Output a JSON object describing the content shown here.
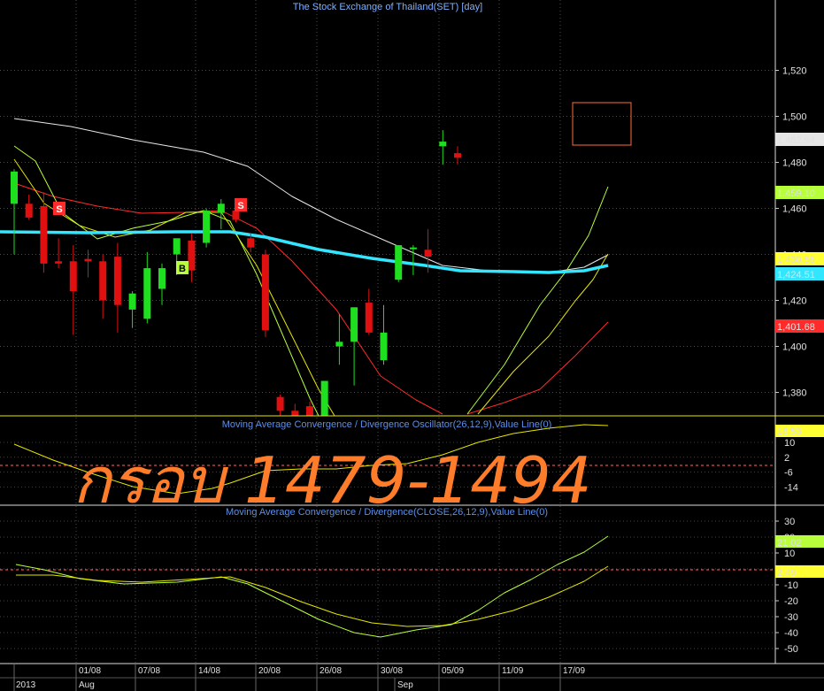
{
  "title": "The Stock Exchange of Thailand(SET) [day]",
  "overlay_text": "กรอบ 1479-1494",
  "x_axis": {
    "year_label": "2013",
    "month_labels": [
      "Aug",
      "Sep"
    ],
    "date_ticks": [
      "01/08",
      "07/08",
      "14/08",
      "20/08",
      "26/08",
      "30/08",
      "05/09",
      "11/09",
      "17/09"
    ]
  },
  "price_panel": {
    "y_ticks": [
      "1,520",
      "1,500",
      "1,480",
      "1,460",
      "1,440",
      "1,420",
      "1,400",
      "1,380"
    ],
    "value_badges": [
      {
        "text": "1,482.94",
        "bg": "#e6e6e6",
        "fg": "#000000"
      },
      {
        "text": "1,459.10",
        "bg": "#b6ff3a",
        "fg": "#000000"
      },
      {
        "text": "1,430.56",
        "bg": "#ffff33",
        "fg": "#000000"
      },
      {
        "text": "1,424.51",
        "bg": "#33e6ff",
        "fg": "#000000"
      },
      {
        "text": "1,401.68",
        "bg": "#ff2a2a",
        "fg": "#000000"
      }
    ],
    "signals": [
      {
        "text": "S",
        "kind": "sell"
      },
      {
        "text": "S",
        "kind": "sell"
      },
      {
        "text": "B",
        "kind": "buy"
      }
    ]
  },
  "osc_panel": {
    "title": "Moving Average Convergence / Divergence Oscillator(26,12,9),Value Line(0)",
    "y_ticks": [
      "10",
      "2",
      "-6",
      "-14"
    ],
    "value_badge": {
      "text": "18.53",
      "bg": "#ffff33",
      "fg": "#000000"
    }
  },
  "macd_panel": {
    "title": "Moving Average Convergence / Divergence(CLOSE,26,12,9),Value Line(0)",
    "y_ticks": [
      "30",
      "20",
      "10",
      "0",
      "-10",
      "-20",
      "-30",
      "-40",
      "-50"
    ],
    "value_badges": [
      {
        "text": "21.02",
        "bg": "#b6ff3a",
        "fg": "#000000"
      },
      {
        "text": "2.49",
        "bg": "#ffff33",
        "fg": "#000000"
      }
    ]
  },
  "colors": {
    "up": "#1fe01f",
    "down": "#e01010",
    "ma_white": "#e8e8e8",
    "ma_yellow": "#e6e600",
    "ma_green": "#b6ff3a",
    "ma_red": "#ff2a2a",
    "ma_cyan": "#33e6ff"
  },
  "chart_data": {
    "type": "candlestick",
    "title": "The Stock Exchange of Thailand(SET) [day]",
    "x_ticks": [
      "01/08",
      "07/08",
      "14/08",
      "20/08",
      "26/08",
      "30/08",
      "05/09",
      "11/09",
      "17/09"
    ],
    "ylim": [
      1370,
      1530
    ],
    "candles": [
      {
        "o": 1462,
        "h": 1477,
        "l": 1440,
        "c": 1476
      },
      {
        "o": 1462,
        "h": 1466,
        "l": 1455,
        "c": 1456
      },
      {
        "o": 1461,
        "h": 1467,
        "l": 1432,
        "c": 1436
      },
      {
        "o": 1437,
        "h": 1447,
        "l": 1434,
        "c": 1436
      },
      {
        "o": 1437,
        "h": 1444,
        "l": 1405,
        "c": 1424
      },
      {
        "o": 1438,
        "h": 1442,
        "l": 1430,
        "c": 1437
      },
      {
        "o": 1437,
        "h": 1440,
        "l": 1412,
        "c": 1420
      },
      {
        "o": 1439,
        "h": 1445,
        "l": 1406,
        "c": 1418
      },
      {
        "o": 1416,
        "h": 1424,
        "l": 1408,
        "c": 1423
      },
      {
        "o": 1412,
        "h": 1441,
        "l": 1410,
        "c": 1434
      },
      {
        "o": 1425,
        "h": 1436,
        "l": 1418,
        "c": 1434
      },
      {
        "o": 1440,
        "h": 1446,
        "l": 1431,
        "c": 1447
      },
      {
        "o": 1446,
        "h": 1449,
        "l": 1428,
        "c": 1433
      },
      {
        "o": 1445,
        "h": 1460,
        "l": 1443,
        "c": 1459
      },
      {
        "o": 1458,
        "h": 1464,
        "l": 1451,
        "c": 1462
      },
      {
        "o": 1459,
        "h": 1461,
        "l": 1454,
        "c": 1455
      },
      {
        "o": 1447,
        "h": 1449,
        "l": 1441,
        "c": 1443
      },
      {
        "o": 1440,
        "h": 1442,
        "l": 1404,
        "c": 1407
      },
      {
        "o": 1378,
        "h": 1379,
        "l": 1370,
        "c": 1372
      },
      {
        "o": 1372,
        "h": 1375,
        "l": 1366,
        "c": 1369
      },
      {
        "o": 1374,
        "h": 1376,
        "l": 1362,
        "c": 1364
      },
      {
        "o": 1370,
        "h": 1385,
        "l": 1358,
        "c": 1385
      },
      {
        "o": 1400,
        "h": 1414,
        "l": 1392,
        "c": 1402
      },
      {
        "o": 1402,
        "h": 1414,
        "l": 1383,
        "c": 1417
      },
      {
        "o": 1419,
        "h": 1425,
        "l": 1405,
        "c": 1406
      },
      {
        "o": 1394,
        "h": 1418,
        "l": 1392,
        "c": 1406
      },
      {
        "o": 1429,
        "h": 1444,
        "l": 1428,
        "c": 1444
      },
      {
        "o": 1443,
        "h": 1444,
        "l": 1431,
        "c": 1443
      },
      {
        "o": 1442,
        "h": 1451,
        "l": 1432,
        "c": 1439
      },
      {
        "o": 1487,
        "h": 1494,
        "l": 1479,
        "c": 1489
      },
      {
        "o": 1484,
        "h": 1487,
        "l": 1479,
        "c": 1482
      }
    ]
  }
}
